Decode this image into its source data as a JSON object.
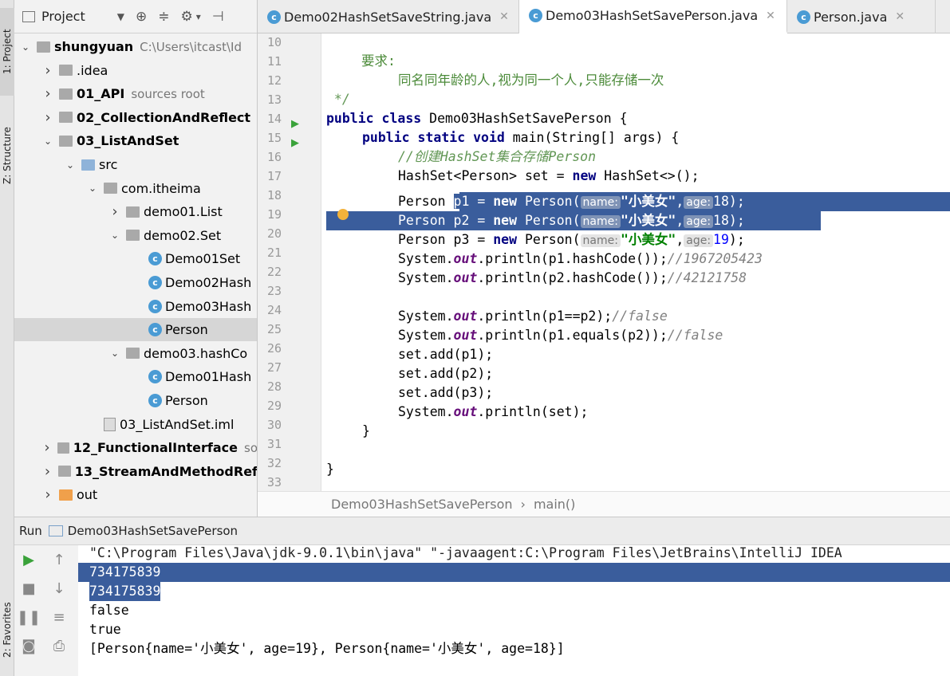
{
  "tool_strip": {
    "project_tab": "1: Project",
    "structure_tab": "Z: Structure",
    "favorites_tab": "2: Favorites"
  },
  "project_panel": {
    "title": "Project",
    "tree": [
      {
        "label": "shungyuan",
        "suffix": "C:\\Users\\itcast\\Id",
        "bold": true,
        "icon": "folder",
        "arrow": "down",
        "depth": 0
      },
      {
        "label": ".idea",
        "icon": "folder",
        "arrow": "right",
        "depth": 1
      },
      {
        "label": "01_API",
        "suffix": "sources root",
        "bold": true,
        "icon": "folder",
        "arrow": "right",
        "depth": 1
      },
      {
        "label": "02_CollectionAndReflect",
        "bold": true,
        "icon": "folder",
        "arrow": "right",
        "depth": 1
      },
      {
        "label": "03_ListAndSet",
        "bold": true,
        "icon": "folder",
        "arrow": "down",
        "depth": 1
      },
      {
        "label": "src",
        "icon": "folder-blue",
        "arrow": "down",
        "depth": 2
      },
      {
        "label": "com.itheima",
        "icon": "folder",
        "arrow": "down",
        "depth": 3
      },
      {
        "label": "demo01.List",
        "icon": "folder",
        "arrow": "right",
        "depth": 4
      },
      {
        "label": "demo02.Set",
        "icon": "folder",
        "arrow": "down",
        "depth": 4
      },
      {
        "label": "Demo01Set",
        "icon": "class",
        "depth": 5
      },
      {
        "label": "Demo02Hash",
        "icon": "class",
        "depth": 5
      },
      {
        "label": "Demo03Hash",
        "icon": "class",
        "depth": 5
      },
      {
        "label": "Person",
        "icon": "class",
        "depth": 5,
        "selected": true
      },
      {
        "label": "demo03.hashCo",
        "icon": "folder",
        "arrow": "down",
        "depth": 4
      },
      {
        "label": "Demo01Hash",
        "icon": "class",
        "depth": 5
      },
      {
        "label": "Person",
        "icon": "class",
        "depth": 5
      },
      {
        "label": "03_ListAndSet.iml",
        "icon": "iml",
        "depth": 3
      },
      {
        "label": "12_FunctionalInterface",
        "suffix": "so",
        "bold": true,
        "icon": "folder",
        "arrow": "right",
        "depth": 1
      },
      {
        "label": "13_StreamAndMethodRef",
        "bold": true,
        "icon": "folder",
        "arrow": "right",
        "depth": 1
      },
      {
        "label": "out",
        "icon": "folder-orange",
        "arrow": "right",
        "depth": 1
      }
    ]
  },
  "tabs": [
    {
      "label": "Demo02HashSetSaveString.java",
      "active": false
    },
    {
      "label": "Demo03HashSetSavePerson.java",
      "active": true
    },
    {
      "label": "Person.java",
      "active": false
    }
  ],
  "editor": {
    "line_numbers": [
      "10",
      "11",
      "12",
      "13",
      "14",
      "15",
      "16",
      "17",
      "18",
      "19",
      "20",
      "21",
      "22",
      "23",
      "24",
      "25",
      "26",
      "27",
      "28",
      "29",
      "30",
      "31",
      "32",
      "33"
    ],
    "code": {
      "l11_doc": "要求:",
      "l12_doc": "同名同年龄的人,视为同一个人,只能存储一次",
      "l13_doc": " */",
      "l14_kw1": "public class",
      "l14_rest": " Demo03HashSetSavePerson {",
      "l15_kw": "public static void",
      "l15_rest": " main(String[] args) {",
      "l16_cm": "//创建HashSet集合存储Person",
      "l17_a": "HashSet<Person> set = ",
      "l17_kw": "new",
      "l17_b": " HashSet<>();",
      "l18_a": "Person ",
      "l18_b": "p1 = ",
      "l19_a": "Person p2 = ",
      "l20_a": "Person p3 = ",
      "kw_new": "new",
      "ctor": " Person(",
      "hint_name": "name:",
      "hint_age": "age:",
      "str_name": "\"小美女\"",
      "comma": ",",
      "age18": "18",
      "age19": "19",
      "close": ");",
      "sys": "System.",
      "out": "out",
      "l21_rest": ".println(p1.hashCode());",
      "l21_cm": "//1967205423",
      "l22_rest": ".println(p2.hashCode());",
      "l22_cm": "//42121758",
      "l24_rest": ".println(p1==p2);",
      "l24_cm": "//false",
      "l25_rest": ".println(p1.equals(p2));",
      "l25_cm": "//false",
      "l26": "set.add(p1);",
      "l27": "set.add(p2);",
      "l28": "set.add(p3);",
      "l29_rest": ".println(set);",
      "l30": "}",
      "l32": "}"
    },
    "breadcrumb": {
      "class": "Demo03HashSetSavePerson",
      "sep": "›",
      "method": "main()"
    }
  },
  "run_panel": {
    "label": "Run",
    "config": "Demo03HashSetSavePerson",
    "console": [
      "\"C:\\Program Files\\Java\\jdk-9.0.1\\bin\\java\" \"-javaagent:C:\\Program Files\\JetBrains\\IntelliJ IDEA",
      "734175839",
      "734175839",
      "false",
      "true",
      "[Person{name='小美女', age=19}, Person{name='小美女', age=18}]"
    ]
  }
}
